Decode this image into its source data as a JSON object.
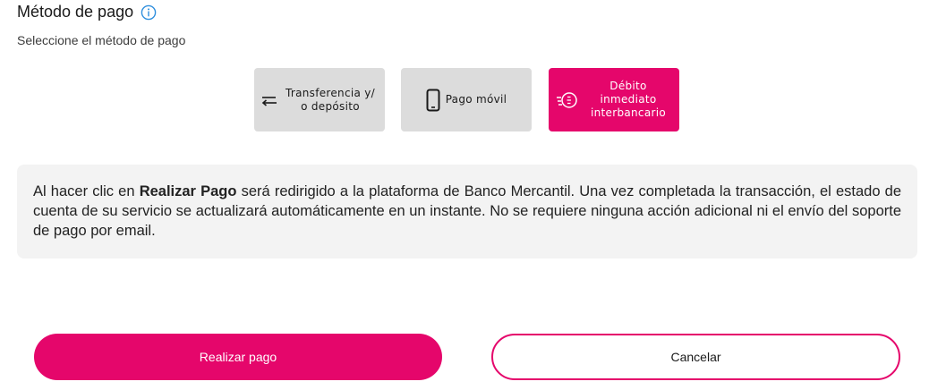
{
  "header": {
    "title": "Método de pago",
    "subtitle": "Seleccione el método de pago",
    "info_icon": "info-circle-icon"
  },
  "payment_methods": [
    {
      "label": "Transferencia y/ o depósito",
      "icon": "transfer-arrows-icon",
      "selected": false
    },
    {
      "label": "Pago móvil",
      "icon": "mobile-phone-icon",
      "selected": false
    },
    {
      "label": "Débito inmediato interbancario",
      "icon": "fast-payment-icon",
      "selected": true
    }
  ],
  "notice": {
    "text_before": "Al hacer clic en ",
    "bold": "Realizar Pago",
    "text_after": " será redirigido a la plataforma de Banco Mercantil. Una vez completada la transacción, el estado de cuenta de su servicio se actualizará automáticamente en un instante. No se requiere ninguna acción adicional ni el envío del soporte de pago por email."
  },
  "actions": {
    "submit_label": "Realizar pago",
    "cancel_label": "Cancelar"
  },
  "colors": {
    "accent": "#e5066b",
    "info": "#2f8fdd",
    "inactive_tile": "#dcdcdc",
    "notice_bg": "#f3f3f3"
  }
}
